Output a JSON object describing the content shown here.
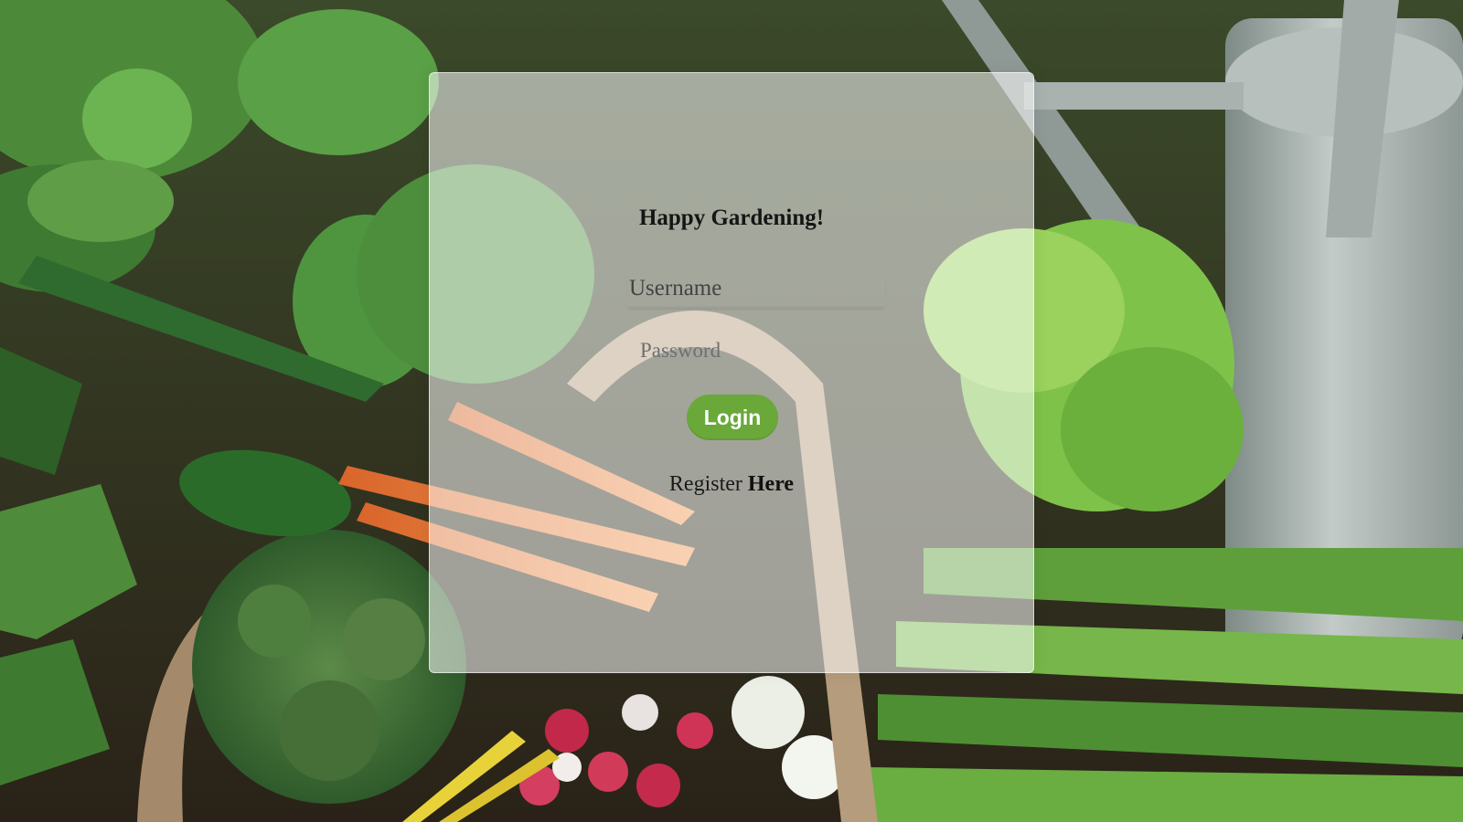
{
  "login_card": {
    "title": "Happy Gardening!",
    "username_placeholder": "Username",
    "password_placeholder": "Password",
    "login_label": "Login",
    "register_text": "Register",
    "register_link_label": "Here"
  },
  "colors": {
    "login_button": "#6aa83a",
    "card_background": "rgba(255,255,255,0.55)",
    "title_text": "#151515"
  },
  "background": {
    "icon": "vegetable-garden-photo"
  }
}
